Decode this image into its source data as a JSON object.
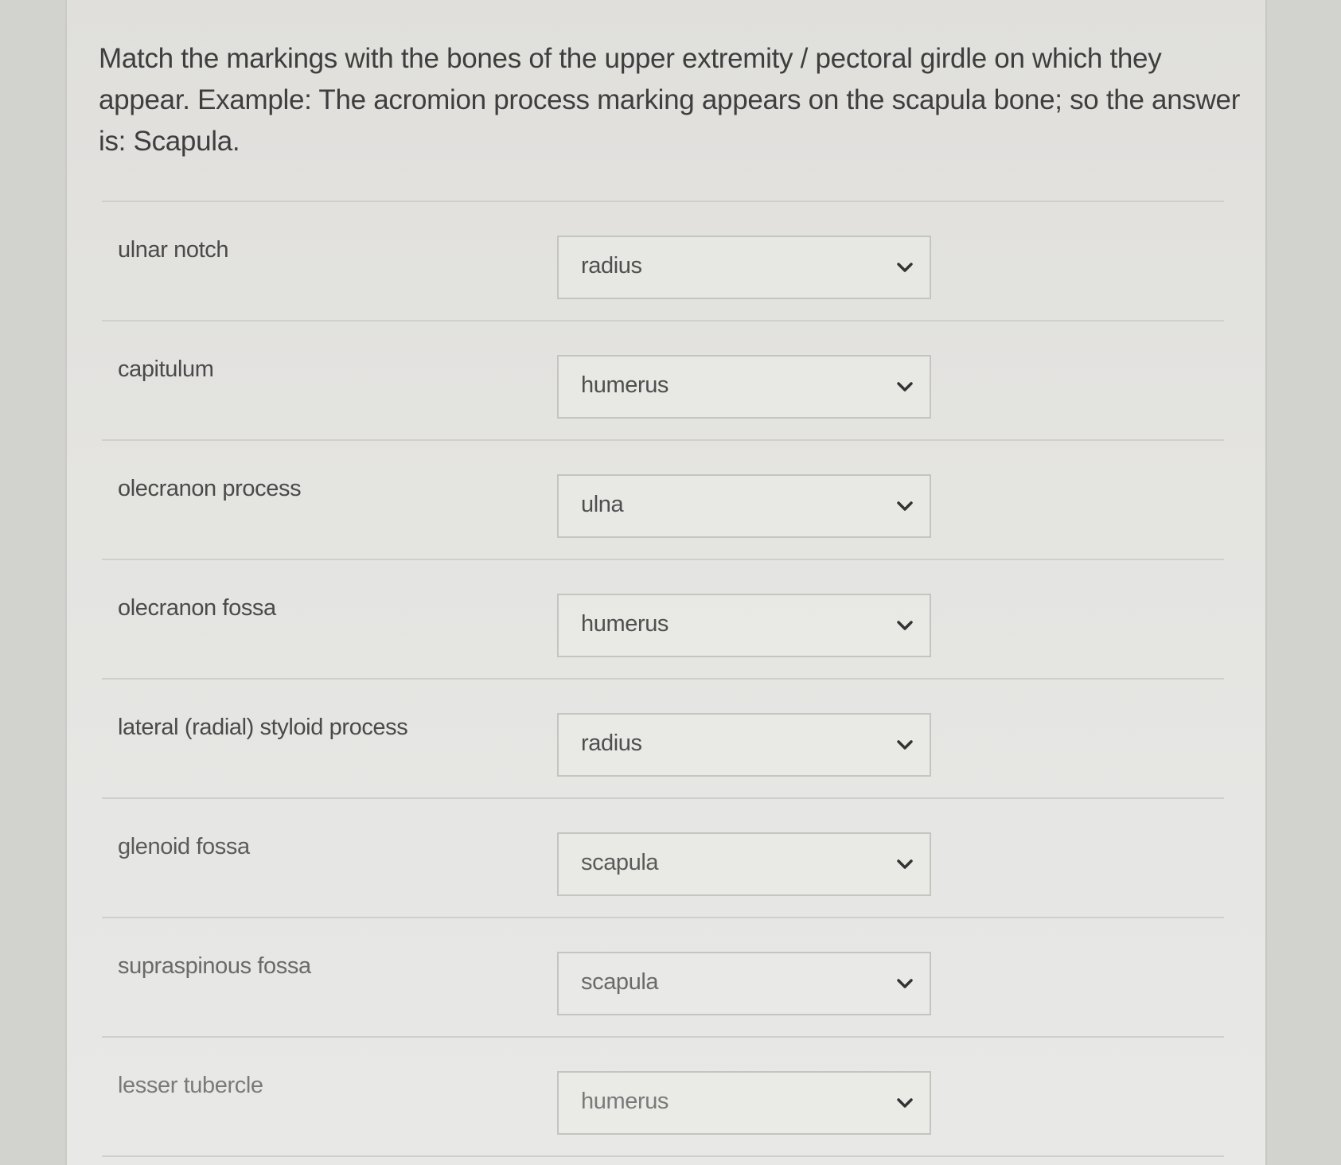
{
  "question": {
    "text": "Match the markings with the bones of the upper extremity / pectoral girdle on which they appear. Example: The acromion process marking appears on the scapula bone; so the answer is: Scapula."
  },
  "icons": {
    "dropdown": "chevron-down-icon"
  },
  "rows": [
    {
      "term": "ulnar notch",
      "answer": "radius"
    },
    {
      "term": "capitulum",
      "answer": "humerus"
    },
    {
      "term": "olecranon process",
      "answer": "ulna"
    },
    {
      "term": "olecranon fossa",
      "answer": "humerus"
    },
    {
      "term": "lateral (radial) styloid process",
      "answer": "radius"
    },
    {
      "term": "glenoid fossa",
      "answer": "scapula"
    },
    {
      "term": "supraspinous fossa",
      "answer": "scapula"
    },
    {
      "term": "lesser tubercle",
      "answer": "humerus"
    }
  ]
}
